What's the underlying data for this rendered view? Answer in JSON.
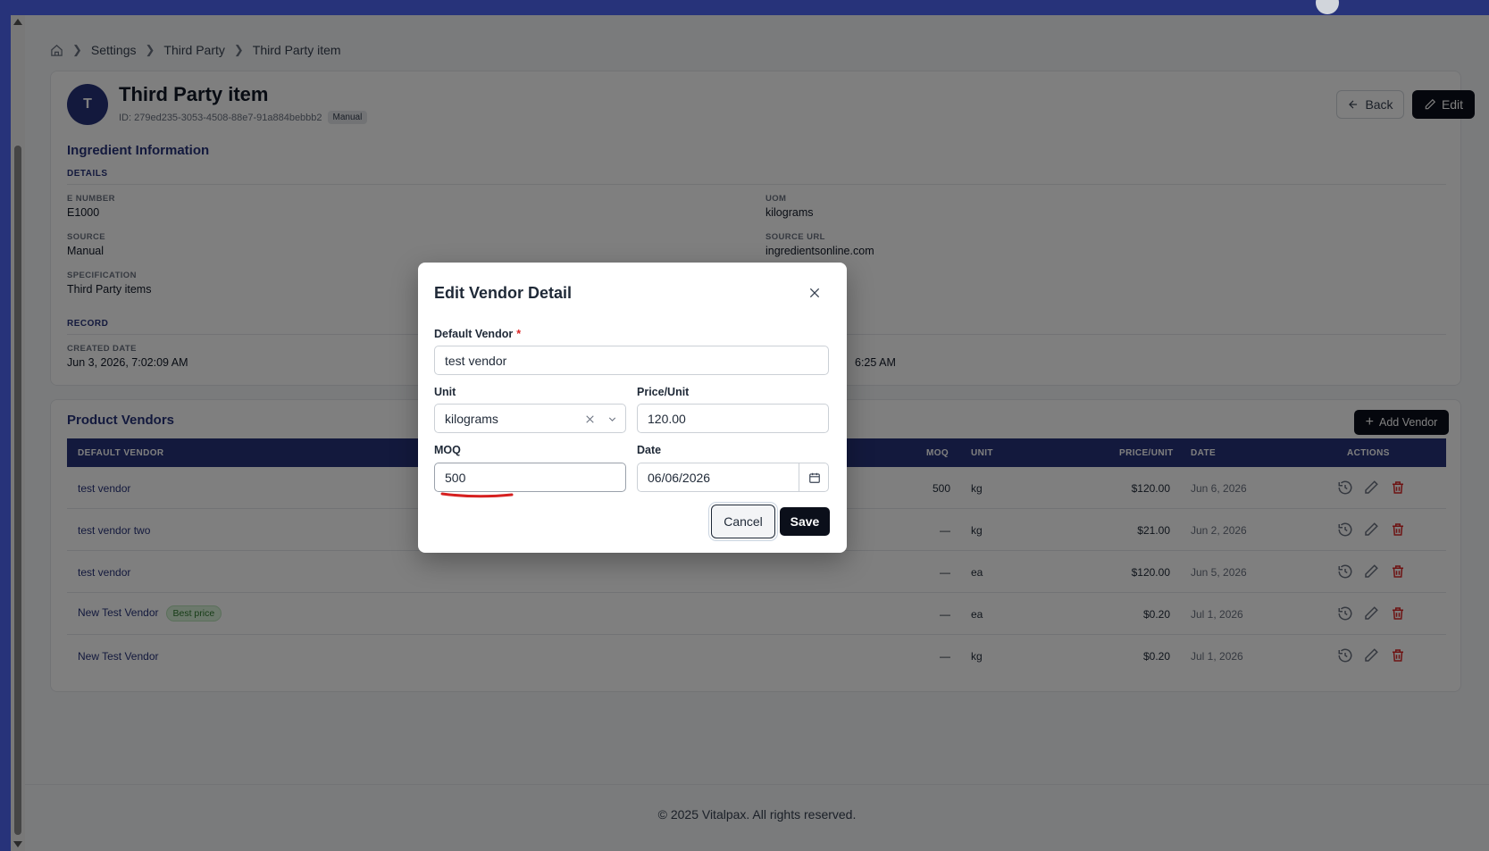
{
  "breadcrumb": {
    "items": [
      "Settings",
      "Third Party",
      "Third Party item"
    ]
  },
  "item": {
    "avatar_letter": "T",
    "title": "Third Party item",
    "id_text": "ID: 279ed235-3053-4508-88e7-91a884bebbb2",
    "badge": "Manual",
    "back_label": "Back",
    "edit_label": "Edit"
  },
  "ingredient": {
    "title": "Ingredient Information",
    "details_head": "DETAILS",
    "e_number_label": "E NUMBER",
    "e_number": "E1000",
    "uom_label": "UOM",
    "uom": "kilograms",
    "source_label": "SOURCE",
    "source": "Manual",
    "source_url_label": "SOURCE URL",
    "source_url": "ingredientsonline.com",
    "spec_label": "SPECIFICATION",
    "spec": "Third Party items",
    "record_head": "RECORD",
    "created_label": "CREATED DATE",
    "created": "Jun 3, 2026, 7:02:09 AM",
    "updated_partial": "6:25 AM"
  },
  "vendors": {
    "title": "Product Vendors",
    "add_label": "Add Vendor",
    "columns": {
      "vendor": "DEFAULT VENDOR",
      "moq": "MOQ",
      "unit": "UNIT",
      "price": "PRICE/UNIT",
      "date": "DATE",
      "actions": "ACTIONS"
    },
    "rows": [
      {
        "name": "test vendor",
        "badge": "",
        "moq": "500",
        "unit": "kg",
        "price": "$120.00",
        "date": "Jun 6, 2026"
      },
      {
        "name": "test vendor two",
        "badge": "",
        "moq": "—",
        "unit": "kg",
        "price": "$21.00",
        "date": "Jun 2, 2026"
      },
      {
        "name": "test vendor",
        "badge": "",
        "moq": "—",
        "unit": "ea",
        "price": "$120.00",
        "date": "Jun 5, 2026"
      },
      {
        "name": "New Test Vendor",
        "badge": "Best price",
        "moq": "—",
        "unit": "ea",
        "price": "$0.20",
        "date": "Jul 1, 2026"
      },
      {
        "name": "New Test Vendor",
        "badge": "",
        "moq": "—",
        "unit": "kg",
        "price": "$0.20",
        "date": "Jul 1, 2026"
      }
    ]
  },
  "modal": {
    "title": "Edit Vendor Detail",
    "vendor_label": "Default Vendor",
    "required_mark": "*",
    "vendor_value": "test vendor",
    "unit_label": "Unit",
    "unit_value": "kilograms",
    "price_label": "Price/Unit",
    "price_value": "120.00",
    "moq_label": "MOQ",
    "moq_value": "500",
    "date_label": "Date",
    "date_value": "06/06/2026",
    "cancel_label": "Cancel",
    "save_label": "Save"
  },
  "footer": {
    "text": "© 2025 Vitalpax. All rights reserved."
  },
  "colors": {
    "brand": "#27337a",
    "primary_button": "#0b0f1a",
    "danger": "#dc2626",
    "annotation": "#d62020"
  }
}
